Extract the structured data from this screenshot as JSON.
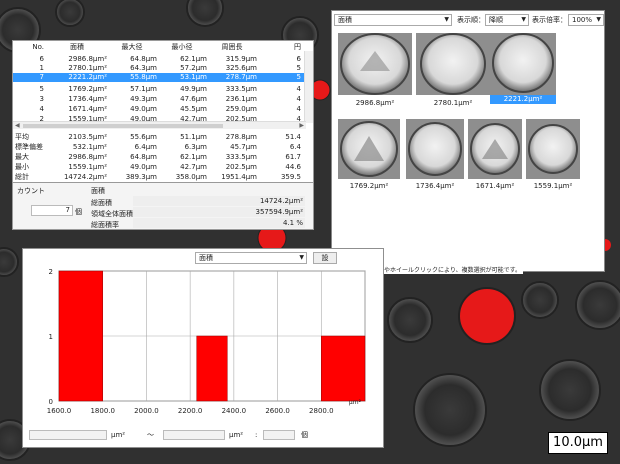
{
  "table": {
    "headers": [
      "No.",
      "面積",
      "最大径",
      "最小径",
      "周囲長",
      "円"
    ],
    "rows": [
      {
        "no": "6",
        "area": "2986.8μm²",
        "max": "64.8μm",
        "min": "62.1μm",
        "peri": "315.9μm",
        "c": "6"
      },
      {
        "no": "1",
        "area": "2780.1μm²",
        "max": "64.3μm",
        "min": "57.2μm",
        "peri": "325.6μm",
        "c": "5"
      },
      {
        "no": "7",
        "area": "2221.2μm²",
        "max": "55.8μm",
        "min": "53.1μm",
        "peri": "278.7μm",
        "c": "5"
      },
      {
        "no": "5",
        "area": "1769.2μm²",
        "max": "57.1μm",
        "min": "49.9μm",
        "peri": "333.5μm",
        "c": "4"
      },
      {
        "no": "3",
        "area": "1736.4μm²",
        "max": "49.3μm",
        "min": "47.6μm",
        "peri": "236.1μm",
        "c": "4"
      },
      {
        "no": "4",
        "area": "1671.4μm²",
        "max": "49.0μm",
        "min": "45.5μm",
        "peri": "259.0μm",
        "c": "4"
      },
      {
        "no": "2",
        "area": "1559.1μm²",
        "max": "49.0μm",
        "min": "42.7μm",
        "peri": "202.5μm",
        "c": "4"
      }
    ],
    "summary": [
      {
        "label": "平均",
        "area": "2103.5μm²",
        "max": "55.6μm",
        "min": "51.1μm",
        "peri": "278.8μm",
        "c": "51.4"
      },
      {
        "label": "標準偏差",
        "area": "532.1μm²",
        "max": "6.4μm",
        "min": "6.3μm",
        "peri": "45.7μm",
        "c": "6.4"
      },
      {
        "label": "最大",
        "area": "2986.8μm²",
        "max": "64.8μm",
        "min": "62.1μm",
        "peri": "333.5μm",
        "c": "61.7"
      },
      {
        "label": "最小",
        "area": "1559.1μm²",
        "max": "49.0μm",
        "min": "42.7μm",
        "peri": "202.5μm",
        "c": "44.6"
      },
      {
        "label": "総計",
        "area": "14724.2μm²",
        "max": "389.3μm",
        "min": "358.0μm",
        "peri": "1951.4μm",
        "c": "359.5"
      }
    ]
  },
  "count_panel": {
    "count_label": "カウント",
    "count_value": "7",
    "count_unit": "個",
    "area_header": "面積",
    "lines": [
      {
        "label": "総面積",
        "value": "14724.2μm²"
      },
      {
        "label": "領域全体面積",
        "value": "357594.9μm²"
      },
      {
        "label": "総面積率",
        "value": "4.1",
        "unit": "%"
      }
    ]
  },
  "thumbnails": {
    "measure_select": "面積",
    "order_label": "表示順：",
    "order_select": "降順",
    "zoom_label": "表示倍率：",
    "zoom_select": "100%",
    "items": [
      {
        "caption": "2986.8μm²",
        "selected": false
      },
      {
        "caption": "2780.1μm²",
        "selected": false
      },
      {
        "caption": "2221.2μm²",
        "selected": true
      },
      {
        "caption": "1769.2μm²",
        "selected": false
      },
      {
        "caption": "1736.4μm²",
        "selected": false
      },
      {
        "caption": "1671.4μm²",
        "selected": false
      },
      {
        "caption": "1559.1μm²",
        "selected": false
      }
    ],
    "note": "*) Ctrl+クリックやホイールクリックにより、複数選択が可能です。"
  },
  "histogram": {
    "measure_select": "面積",
    "button_label": "設",
    "tilde": "～",
    "unit1": "μm²",
    "unit2": "μm²",
    "colon": ":",
    "count_unit": "個"
  },
  "chart_data": {
    "type": "bar",
    "bin_edges": [
      1600,
      1800,
      2000,
      2200,
      2400,
      2600,
      2800,
      3000
    ],
    "tick_labels": [
      "1600.0",
      "1800.0",
      "2000.0",
      "2200.0",
      "2400.0",
      "2600.0",
      "2800.0"
    ],
    "values": [
      2,
      0,
      0,
      1,
      0,
      0,
      1
    ],
    "y_ticks": [
      "0",
      "1",
      "2"
    ],
    "ylim": [
      0,
      2
    ],
    "x_unit": "μm²",
    "bar_color": "#ff0000",
    "grid": true
  },
  "scale_bar": "10.0μm"
}
